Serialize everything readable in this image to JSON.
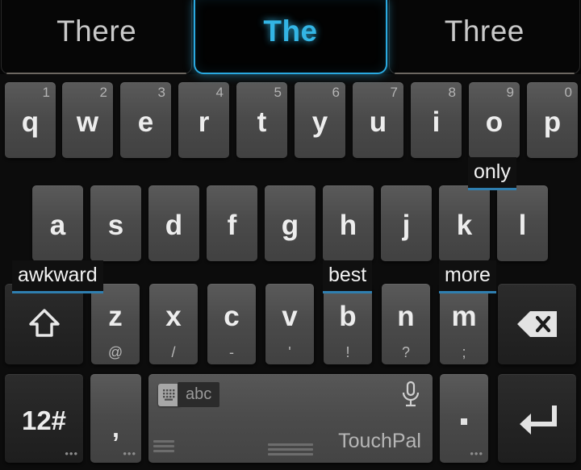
{
  "suggestions": [
    {
      "text": "There",
      "selected": false
    },
    {
      "text": "The",
      "selected": true
    },
    {
      "text": "Three",
      "selected": false
    }
  ],
  "colors": {
    "accent_blue": "#33b5e5",
    "hint_underline": "#2f7fb0",
    "key_face": "#4a4a4a",
    "key_dark": "#242424",
    "background": "#0c0c0c",
    "key_text": "#ededed"
  },
  "rows": {
    "row1": [
      {
        "label": "q",
        "num": "1"
      },
      {
        "label": "w",
        "num": "2"
      },
      {
        "label": "e",
        "num": "3"
      },
      {
        "label": "r",
        "num": "4"
      },
      {
        "label": "t",
        "num": "5"
      },
      {
        "label": "y",
        "num": "6"
      },
      {
        "label": "u",
        "num": "7"
      },
      {
        "label": "i",
        "num": "8"
      },
      {
        "label": "o",
        "num": "9",
        "word_hint": "only"
      },
      {
        "label": "p",
        "num": "0"
      }
    ],
    "row2": [
      {
        "label": "a",
        "word_hint": "awkward"
      },
      {
        "label": "s"
      },
      {
        "label": "d"
      },
      {
        "label": "f"
      },
      {
        "label": "g"
      },
      {
        "label": "h",
        "word_hint": "best"
      },
      {
        "label": "j"
      },
      {
        "label": "k",
        "word_hint": "more"
      },
      {
        "label": "l"
      }
    ],
    "row3": [
      {
        "label": "z",
        "sym": "@"
      },
      {
        "label": "x",
        "sym": "/"
      },
      {
        "label": "c",
        "sym": "-"
      },
      {
        "label": "v",
        "sym": "'"
      },
      {
        "label": "b",
        "sym": "!"
      },
      {
        "label": "n",
        "sym": "?"
      },
      {
        "label": "m",
        "sym": ";"
      }
    ]
  },
  "special_keys": {
    "shift": {
      "icon": "shift-arrow-icon",
      "label": ""
    },
    "backspace": {
      "icon": "backspace-icon",
      "label": ""
    },
    "symbols": {
      "label": "12#",
      "dots": "•••"
    },
    "comma": {
      "label": ",",
      "dots": "•••"
    },
    "period": {
      "label": ".",
      "dots": "•••"
    },
    "enter": {
      "icon": "enter-return-icon",
      "label": ""
    }
  },
  "spacebar": {
    "layout_label": "abc",
    "grid_icon": "keyboard-grid-icon",
    "mic_icon": "microphone-icon",
    "brand": "TouchPal"
  }
}
